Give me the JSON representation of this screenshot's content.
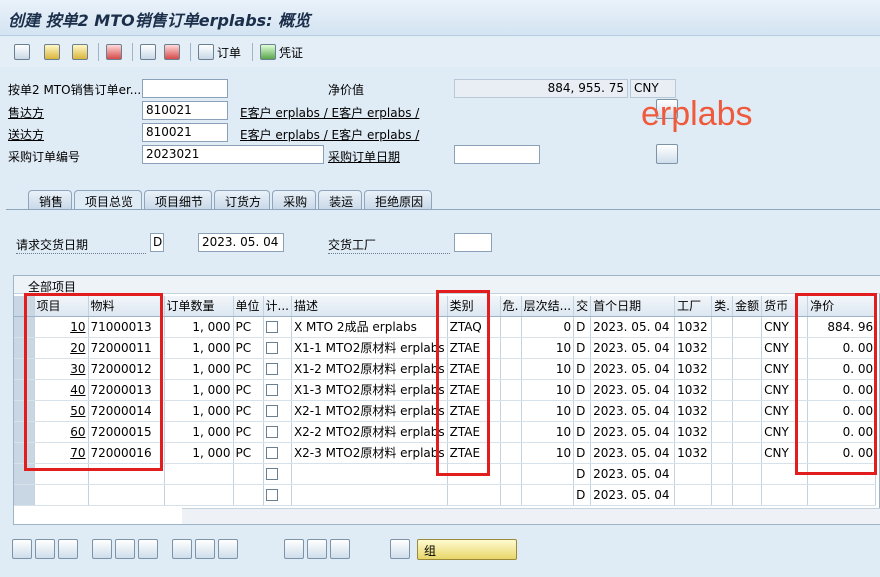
{
  "window": {
    "title": "创建 按单2 MTO销售订单erplabs: 概览"
  },
  "toolbar": {
    "order_label": "订单",
    "voucher_label": "凭证"
  },
  "header": {
    "doc_label": "按单2 MTO销售订单er...",
    "doc_value": "",
    "net_value_label": "净价值",
    "net_value": "884, 955. 75",
    "currency": "CNY",
    "sold_to_label": "售达方",
    "sold_to": "810021",
    "sold_to_name": "E客户 erplabs / E客户 erplabs /",
    "ship_to_label": "送达方",
    "ship_to": "810021",
    "ship_to_name": "E客户 erplabs / E客户 erplabs /",
    "po_label": "采购订单编号",
    "po_number": "2023021",
    "po_date_label": "采购订单日期",
    "po_date": ""
  },
  "watermark": "erplabs",
  "tabs": [
    "销售",
    "项目总览",
    "项目细节",
    "订货方",
    "采购",
    "装运",
    "拒绝原因"
  ],
  "overview": {
    "req_date_label": "请求交货日期",
    "req_date_type": "D",
    "req_date": "2023. 05. 04",
    "plant_label": "交货工厂",
    "plant": ""
  },
  "grid": {
    "title": "全部项目",
    "columns": [
      "项目",
      "物料",
      "订单数量",
      "单位",
      "计...",
      "描述",
      "类别",
      "危.",
      "层次结...",
      "交",
      "首个日期",
      "工厂",
      "类.",
      "金额",
      "货币",
      "净价"
    ],
    "rows": [
      {
        "item": "10",
        "material": "71000013",
        "qty": "1, 000",
        "unit": "PC",
        "desc": "X MTO 2成品 erplabs",
        "cat": "ZTAQ",
        "hier": "0",
        "dt": "D",
        "date": "2023. 05. 04",
        "plant": "1032",
        "cur": "CNY",
        "net": "884. 96"
      },
      {
        "item": "20",
        "material": "72000011",
        "qty": "1, 000",
        "unit": "PC",
        "desc": "X1-1 MTO2原材料 erplabs",
        "cat": "ZTAE",
        "hier": "10",
        "dt": "D",
        "date": "2023. 05. 04",
        "plant": "1032",
        "cur": "CNY",
        "net": "0. 00"
      },
      {
        "item": "30",
        "material": "72000012",
        "qty": "1, 000",
        "unit": "PC",
        "desc": "X1-2 MTO2原材料 erplabs",
        "cat": "ZTAE",
        "hier": "10",
        "dt": "D",
        "date": "2023. 05. 04",
        "plant": "1032",
        "cur": "CNY",
        "net": "0. 00"
      },
      {
        "item": "40",
        "material": "72000013",
        "qty": "1, 000",
        "unit": "PC",
        "desc": "X1-3 MTO2原材料 erplabs",
        "cat": "ZTAE",
        "hier": "10",
        "dt": "D",
        "date": "2023. 05. 04",
        "plant": "1032",
        "cur": "CNY",
        "net": "0. 00"
      },
      {
        "item": "50",
        "material": "72000014",
        "qty": "1, 000",
        "unit": "PC",
        "desc": "X2-1 MTO2原材料 erplabs",
        "cat": "ZTAE",
        "hier": "10",
        "dt": "D",
        "date": "2023. 05. 04",
        "plant": "1032",
        "cur": "CNY",
        "net": "0. 00"
      },
      {
        "item": "60",
        "material": "72000015",
        "qty": "1, 000",
        "unit": "PC",
        "desc": "X2-2 MTO2原材料 erplabs",
        "cat": "ZTAE",
        "hier": "10",
        "dt": "D",
        "date": "2023. 05. 04",
        "plant": "1032",
        "cur": "CNY",
        "net": "0. 00"
      },
      {
        "item": "70",
        "material": "72000016",
        "qty": "1, 000",
        "unit": "PC",
        "desc": "X2-3 MTO2原材料 erplabs",
        "cat": "ZTAE",
        "hier": "10",
        "dt": "D",
        "date": "2023. 05. 04",
        "plant": "1032",
        "cur": "CNY",
        "net": "0. 00"
      },
      {
        "item": "",
        "material": "",
        "qty": "",
        "unit": "",
        "desc": "",
        "cat": "",
        "hier": "",
        "dt": "D",
        "date": "2023. 05. 04",
        "plant": "",
        "cur": "",
        "net": ""
      },
      {
        "item": "",
        "material": "",
        "qty": "",
        "unit": "",
        "desc": "",
        "cat": "",
        "hier": "",
        "dt": "D",
        "date": "2023. 05. 04",
        "plant": "",
        "cur": "",
        "net": ""
      }
    ]
  },
  "bottom": {
    "group_label": "组"
  },
  "colors": {
    "highlight_box": "#e11d1d",
    "watermark": "#f05a3c"
  }
}
